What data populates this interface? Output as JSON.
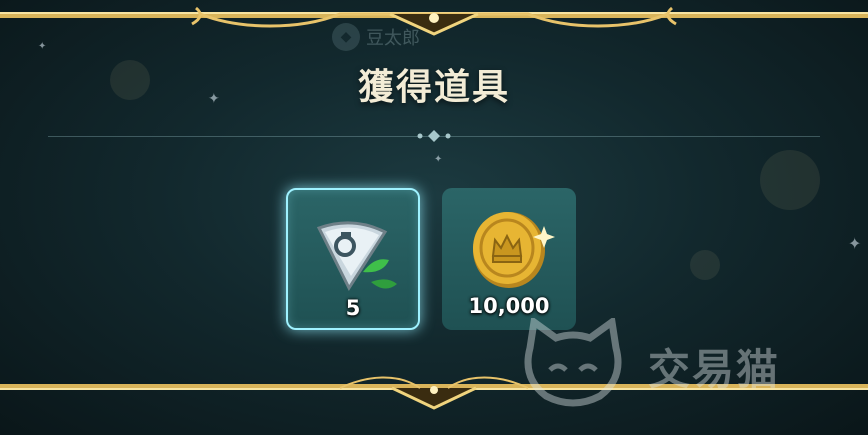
{
  "dialog": {
    "title": "獲得道具",
    "ghost_player_name": "豆太郎"
  },
  "items": [
    {
      "name": "stone-shard-icon",
      "quantity": "5",
      "selected": true
    },
    {
      "name": "gold-coin-icon",
      "quantity": "10,000",
      "selected": false
    }
  ],
  "watermark": {
    "text": "交易猫"
  },
  "colors": {
    "frame_gold": "#e8c36a",
    "panel_teal": "#235a5c",
    "highlight": "#9ff2ff",
    "title_text": "#f3ecd6"
  }
}
